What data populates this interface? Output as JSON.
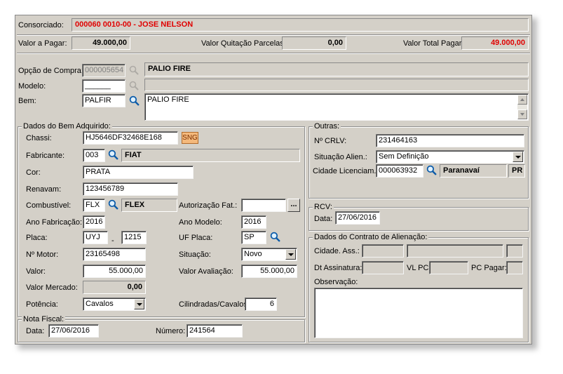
{
  "header": {
    "consorciado_label": "Consorciado:",
    "consorciado_value": "000060 0010-00 - JOSE NELSON",
    "valor_pagar_label": "Valor a Pagar:",
    "valor_pagar_value": "49.000,00",
    "valor_quitacao_label": "Valor Quitação Parcelas:",
    "valor_quitacao_value": "0,00",
    "valor_total_label": "Valor Total Pagar:",
    "valor_total_value": "49.000,00"
  },
  "compra": {
    "opcao_label": "Opção de Compra:",
    "opcao_value": "000005654",
    "opcao_desc": "PALIO FIRE",
    "modelo_label": "Modelo:",
    "modelo_value": "______",
    "bem_label": "Bem:",
    "bem_value": "PALFIR",
    "bem_desc": "PALIO FIRE"
  },
  "dados_bem": {
    "title": "Dados do Bem Adquirido:",
    "chassi_label": "Chassi:",
    "chassi_value": "HJ5646DF32468E168",
    "sng_label": "SNG",
    "fabricante_label": "Fabricante:",
    "fabricante_code": "003",
    "fabricante_name": "FIAT",
    "cor_label": "Cor:",
    "cor_value": "PRATA",
    "renavam_label": "Renavam:",
    "renavam_value": "123456789",
    "combustivel_label": "Combustível:",
    "combustivel_code": "FLX",
    "combustivel_name": "FLEX",
    "autorizacao_label": "Autorização Fat.:",
    "autorizacao_value": "",
    "autorizacao_button": "...",
    "ano_fab_label": "Ano Fabricação:",
    "ano_fab_value": "2016",
    "ano_modelo_label": "Ano Modelo:",
    "ano_modelo_value": "2016",
    "placa_label": "Placa:",
    "placa_letters": "UYJ",
    "placa_sep": "-",
    "placa_numbers": "1215",
    "uf_label": "UF Placa:",
    "uf_value": "SP",
    "motor_label": "Nº Motor:",
    "motor_value": "23165498",
    "situacao_label": "Situação:",
    "situacao_value": "Novo",
    "valor_label": "Valor:",
    "valor_value": "55.000,00",
    "valor_aval_label": "Valor Avaliação:",
    "valor_aval_value": "55.000,00",
    "valor_mercado_label": "Valor Mercado:",
    "valor_mercado_value": "0,00",
    "potencia_label": "Potência:",
    "potencia_value": "Cavalos",
    "cilindradas_label": "Cilindradas/Cavalos:",
    "cilindradas_value": "6"
  },
  "outras": {
    "title": "Outras:",
    "crlv_label": "Nº CRLV:",
    "crlv_value": "231464163",
    "situacao_label": "Situação Alien.:",
    "situacao_value": "Sem Definição",
    "cidade_label": "Cidade Licenciam.",
    "cidade_code": "000063932",
    "cidade_name": "Paranavaí",
    "cidade_uf": "PR"
  },
  "rcv": {
    "title": "RCV:",
    "data_label": "Data:",
    "data_value": "27/06/2016"
  },
  "contrato": {
    "title": "Dados do Contrato de Alienação:",
    "cidade_label": "Cidade. Ass.:",
    "dt_label": "Dt Assinatura:",
    "vlpc_label": "VL PC:",
    "pcpagar_label": "PC Pagar:",
    "obs_label": "Observação:",
    "obs_value": ""
  },
  "nota": {
    "title": "Nota Fiscal:",
    "data_label": "Data:",
    "data_value": "27/06/2016",
    "numero_label": "Número:",
    "numero_value": "241564"
  },
  "colors": {
    "accent_red": "#e00000",
    "panel": "#d4d0c8",
    "sng": "#f4b97c"
  },
  "icons": [
    "search-icon",
    "dropdown-arrow-icon",
    "scroll-up-icon",
    "scroll-down-icon"
  ]
}
